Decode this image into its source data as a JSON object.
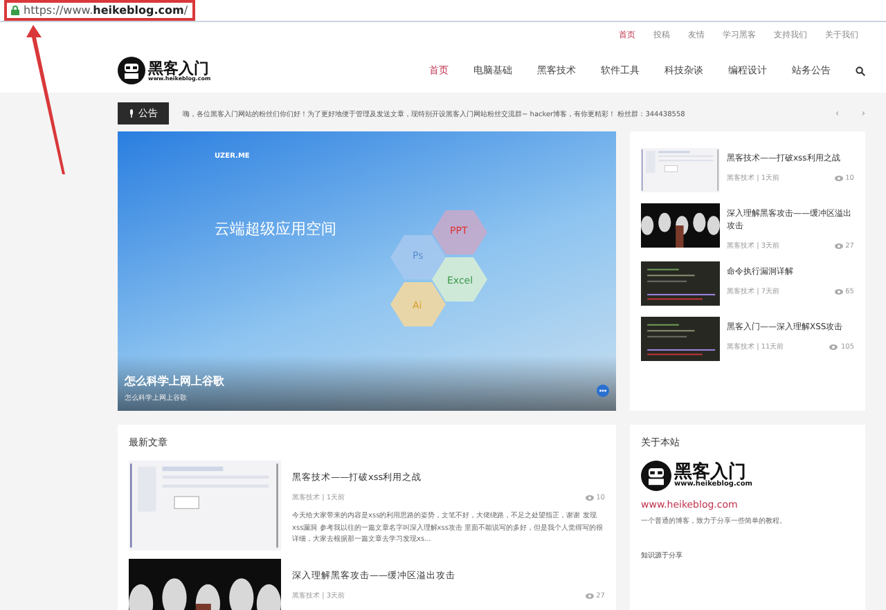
{
  "address_bar": {
    "url_prefix": "https://www.",
    "url_domain": "heikeblog.com",
    "url_suffix": "/"
  },
  "top_links": [
    {
      "label": "首页",
      "selected": true
    },
    {
      "label": "投稿",
      "selected": false
    },
    {
      "label": "友情",
      "selected": false
    },
    {
      "label": "学习黑客",
      "selected": false
    },
    {
      "label": "支持我们",
      "selected": false
    },
    {
      "label": "关于我们",
      "selected": false
    }
  ],
  "logo": {
    "name": "黑客入门",
    "domain": "www.heikeblog.com"
  },
  "nav": [
    {
      "label": "首页",
      "selected": true
    },
    {
      "label": "电脑基础",
      "selected": false
    },
    {
      "label": "黑客技术",
      "selected": false
    },
    {
      "label": "软件工具",
      "selected": false
    },
    {
      "label": "科技杂谈",
      "selected": false
    },
    {
      "label": "编程设计",
      "selected": false
    },
    {
      "label": "站务公告",
      "selected": false
    }
  ],
  "notice": {
    "label": "公告",
    "prev": "‹",
    "next": "›",
    "text": "嗨，各位黑客入门网站的粉丝们你们好！为了更好地便于管理及发送文章，现特别开设黑客入门网站粉丝交流群~ hacker博客，有你更精彩！ 粉丝群：344438558"
  },
  "slider": {
    "brand": "UZER.ME",
    "headline": "云端超级应用空间",
    "tags": [
      "PPT",
      "Ps",
      "Excel",
      "Ai"
    ],
    "title": "怎么科学上网上谷歌",
    "subtitle": "怎么科学上网上谷歌"
  },
  "side_posts": [
    {
      "title": "黑客技术——打破xss利用之战",
      "meta": "黑客技术 | 1天前",
      "views": "10",
      "kind": "light"
    },
    {
      "title": "深入理解黑客攻击——缓冲区溢出攻击",
      "meta": "黑客技术 | 3天前",
      "views": "27",
      "kind": "masks"
    },
    {
      "title": "命令执行漏洞详解",
      "meta": "黑客技术 | 7天前",
      "views": "65",
      "kind": "code"
    },
    {
      "title": "黑客入门——深入理解XSS攻击",
      "meta": "黑客技术 | 11天前",
      "views": "105",
      "kind": "code"
    }
  ],
  "latest": {
    "heading": "最新文章",
    "articles": [
      {
        "title": "黑客技术——打破xss利用之战",
        "meta": "黑客技术 | 1天前",
        "views": "10",
        "excerpt": "今天给大家带来的内容是xss的利用思路的姿势，文笔不好，大佬绕路，不足之处望指正，谢谢 发现xss漏洞 参考我以往的一篇文章名字叫深入理解xss攻击 里面不能说写的多好，但是我个人觉得写的很详细，大家去根据那一篇文章去学习发现xs...",
        "kind": "light"
      },
      {
        "title": "深入理解黑客攻击——缓冲区溢出攻击",
        "meta": "黑客技术 | 3天前",
        "views": "27",
        "kind": "masks"
      }
    ]
  },
  "about": {
    "heading": "关于本站",
    "logo_name": "黑客入门",
    "logo_domain": "www.heikeblog.com",
    "link": "www.heikeblog.com",
    "slogan": "一个普通的博客，致力于分享一些简单的教程。",
    "subheading": "知识源于分享"
  }
}
